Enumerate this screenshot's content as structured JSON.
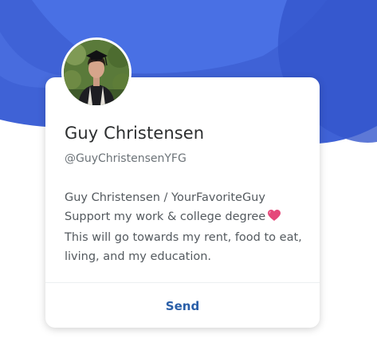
{
  "profile": {
    "name": "Guy Christensen",
    "handle": "@GuyChristensenYFG",
    "bio_lines": [
      "Guy Christensen / YourFavoriteGuy",
      "Support my work & college degree",
      "This will go towards my rent, food to eat,",
      "living, and my education."
    ],
    "bio_emoji_icon": "heart-icon"
  },
  "actions": {
    "send_label": "Send"
  },
  "colors": {
    "header_blue": "#3f62d6",
    "header_blue_light": "#4d74e6",
    "header_blue_dark": "#2f4fc2",
    "send_text": "#2a5fa8",
    "heart": "#e5487a"
  }
}
